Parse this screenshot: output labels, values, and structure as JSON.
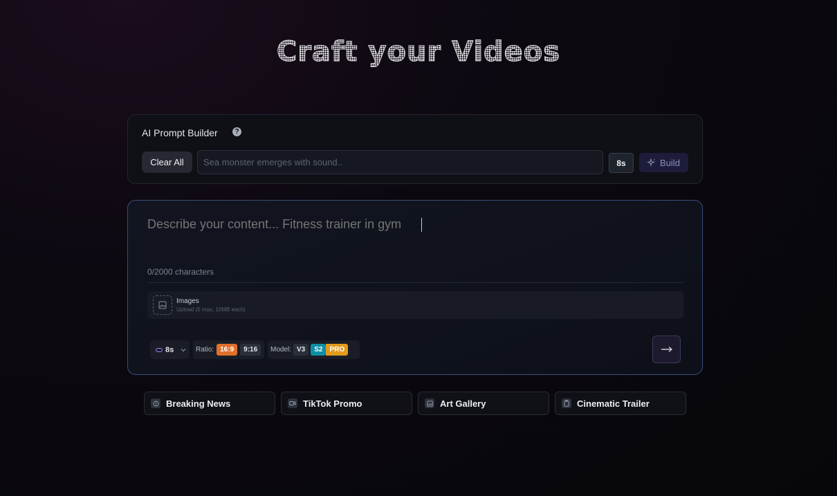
{
  "hero": {
    "title": "Craft your Videos"
  },
  "builder": {
    "title": "AI Prompt Builder",
    "help_icon": "help-circle-icon",
    "clear_label": "Clear All",
    "input_placeholder": "Sea monster emerges with sound..",
    "duration_label": "8s",
    "build_label": "Build",
    "build_icon": "sparkle-icon"
  },
  "composer": {
    "placeholder": "Describe your content... Fitness trainer in gym",
    "char_count": "0/2000 characters",
    "upload": {
      "title": "Images",
      "subtitle": "Upload (5 max, 10MB each)",
      "icon": "image-icon"
    },
    "duration": "8s",
    "ratio": {
      "label": "Ratio:",
      "options": [
        "16:9",
        "9:16"
      ],
      "selected": "16:9"
    },
    "model": {
      "label": "Model:",
      "options": [
        "V3",
        "S2",
        "PRO"
      ]
    },
    "send_icon": "arrow-right-icon"
  },
  "templates": [
    {
      "label": "Breaking News",
      "icon": "alert-circle-icon"
    },
    {
      "label": "TikTok Promo",
      "icon": "video-icon"
    },
    {
      "label": "Art Gallery",
      "icon": "image-icon"
    },
    {
      "label": "Cinematic Trailer",
      "icon": "clipboard-icon"
    }
  ],
  "colors": {
    "accent_orange": "#e0702a",
    "accent_teal": "#0d8fa6",
    "accent_amber": "#e39a1c",
    "accent_purple": "#9b7cff",
    "focus_border": "#3c4c7a"
  }
}
